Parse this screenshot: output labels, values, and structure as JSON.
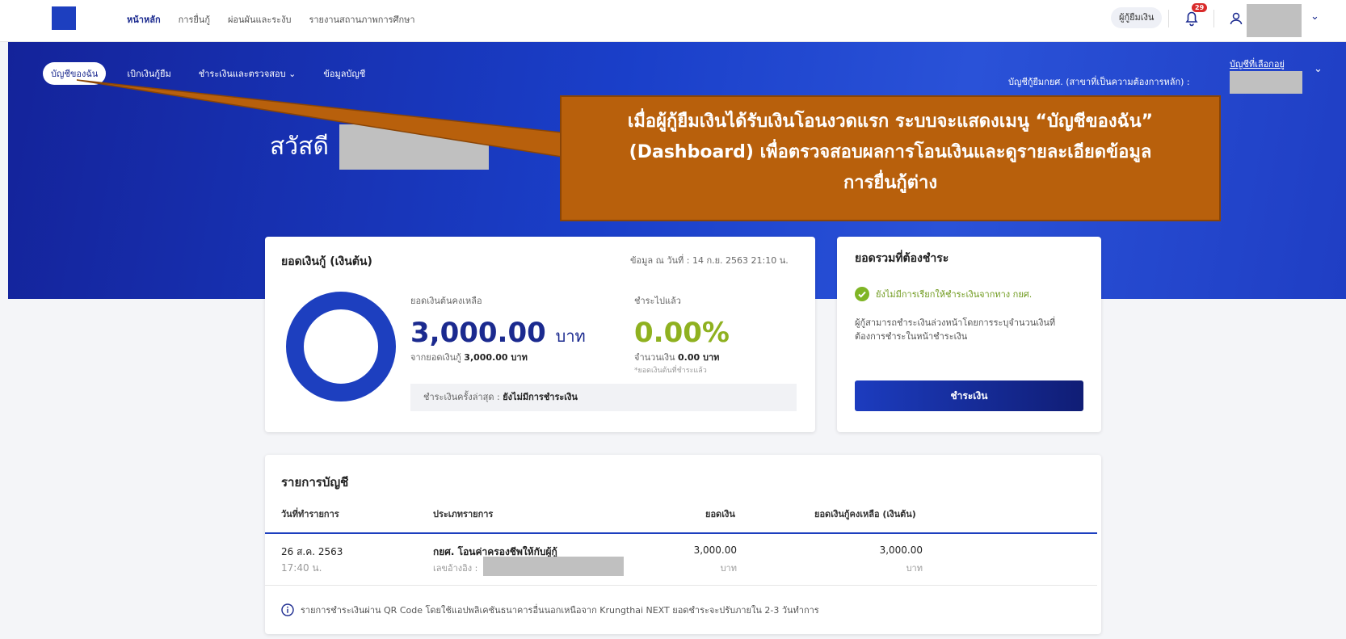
{
  "topbar": {
    "nav": [
      "หน้าหลัก",
      "การยื่นกู้",
      "ผ่อนผันและระงับ",
      "รายงานสถานภาพการศึกษา"
    ],
    "role_button": "ผู้กู้ยืมเงิน",
    "notification_count": "29"
  },
  "subnav": {
    "items": [
      "บัญชีของฉัน",
      "เบิกเงินกู้ยืม",
      "ชำระเงินและตรวจสอบ ⌄",
      "ข้อมูลบัญชี"
    ],
    "account_label": "บัญชีกู้ยืมกยศ. (สาขาที่เป็นความต้องการหลัก) :",
    "selected_account": "บัญชีที่เลือกอยู่"
  },
  "greeting": "สวัสดี",
  "callout": {
    "lines": [
      "เมื่อผู้กู้ยืมเงินได้รับเงินโอนงวดแรก ระบบจะแสดงเมนู “บัญชีของฉัน”",
      "(Dashboard) เพื่อตรวจสอบผลการโอนเงินและดูรายละเอียดข้อมูล",
      "การยื่นกู้ต่าง"
    ]
  },
  "loan_card": {
    "title": "ยอดเงินกู้ (เงินต้น)",
    "as_of": "ข้อมูล ณ วันที่ : 14 ก.ย. 2563 21:10 น.",
    "remaining_label": "ยอดเงินต้นคงเหลือ",
    "remaining_value": "3,000.00",
    "unit": "บาท",
    "from_total_prefix": "จากยอดเงินกู้",
    "from_total_value": "3,000.00 บาท",
    "paid_label": "ชำระไปแล้ว",
    "paid_percent": "0.00%",
    "paid_amount_prefix": "จำนวนเงิน",
    "paid_amount_value": "0.00 บาท",
    "paid_note": "*ยอดเงินต้นที่ชำระแล้ว",
    "last_payment_label": "ชำระเงินครั้งล่าสุด :",
    "last_payment_value": "ยังไม่มีการชำระเงิน",
    "ring_color": "#1d3fbf"
  },
  "due_card": {
    "title": "ยอดรวมที่ต้องชำระ",
    "status": "ยังไม่มีการเรียกให้ชำระเงินจากทาง กยศ.",
    "desc_line1": "ผู้กู้สามารถชำระเงินล่วงหน้าโดยการระบุจำนวนเงินที่",
    "desc_line2": "ต้องการชำระในหน้าชำระเงิน",
    "pay_button": "ชำระเงิน"
  },
  "transactions": {
    "title": "รายการบัญชี",
    "headers": [
      "วันที่ทำรายการ",
      "ประเภทรายการ",
      "ยอดเงิน",
      "ยอดเงินกู้คงเหลือ (เงินต้น)"
    ],
    "rows": [
      {
        "date": "26 ส.ค. 2563",
        "time": "17:40 น.",
        "type": "กยศ. โอนค่าครองชีพให้กับผู้กู้",
        "ref_label": "เลขอ้างอิง :",
        "amount": "3,000.00",
        "amount_unit": "บาท",
        "balance": "3,000.00",
        "balance_unit": "บาท"
      }
    ],
    "note": "รายการชำระเงินผ่าน QR Code โดยใช้แอปพลิเคชันธนาคารอื่นนอกเหนือจาก Krungthai NEXT ยอดชำระจะปรับภายใน 2-3 วันทำการ"
  }
}
